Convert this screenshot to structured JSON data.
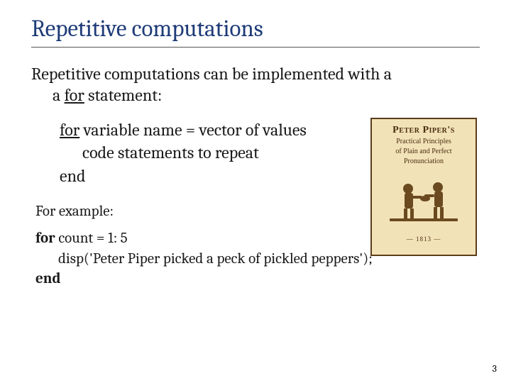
{
  "title": "Repetitive computations",
  "intro_pre": "Repetitive computations can be implemented with a ",
  "intro_keyword": "for",
  "intro_post": " statement:",
  "syntax": {
    "line1_kw": "for",
    "line1_rest": " variable name = vector of values",
    "line2": "code statements to repeat",
    "line3": "end"
  },
  "example_label": "For example:",
  "code": {
    "line1_kw": "for",
    "line1_rest": " count = 1: 5",
    "line2": "disp('Peter Piper picked a peck of pickled peppers');",
    "line3_kw": "end"
  },
  "figure": {
    "title": "Peter Piper's",
    "sub1": "Practical Principles",
    "sub2": "of Plain and Perfect",
    "sub3": "Pronunciation",
    "year": "— 1813 —"
  },
  "page_number": "3"
}
